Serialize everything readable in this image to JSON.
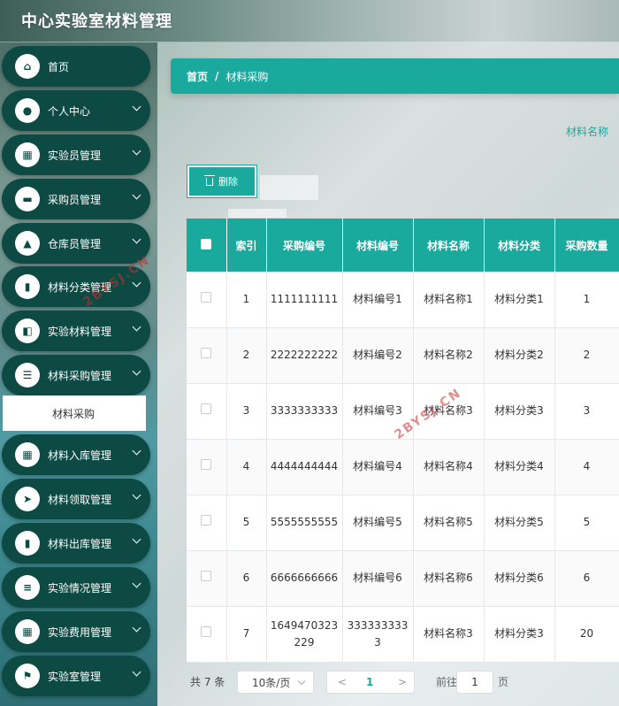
{
  "app": {
    "title": "中心实验室材料管理"
  },
  "sidebar": {
    "items": [
      {
        "label": "首页",
        "icon": "home-icon",
        "expandable": false
      },
      {
        "label": "个人中心",
        "icon": "user-icon",
        "expandable": true
      },
      {
        "label": "实验员管理",
        "icon": "grid-icon",
        "expandable": true
      },
      {
        "label": "采购员管理",
        "icon": "briefcase-icon",
        "expandable": true
      },
      {
        "label": "仓库员管理",
        "icon": "person-icon",
        "expandable": true
      },
      {
        "label": "材料分类管理",
        "icon": "bar-chart-icon",
        "expandable": true
      },
      {
        "label": "实验材料管理",
        "icon": "wallet-icon",
        "expandable": true
      },
      {
        "label": "材料采购管理",
        "icon": "list-icon",
        "expandable": true
      },
      {
        "label": "材料入库管理",
        "icon": "apps-icon",
        "expandable": true
      },
      {
        "label": "材料领取管理",
        "icon": "send-icon",
        "expandable": true
      },
      {
        "label": "材料出库管理",
        "icon": "book-icon",
        "expandable": true
      },
      {
        "label": "实验情况管理",
        "icon": "sliders-icon",
        "expandable": true
      },
      {
        "label": "实验费用管理",
        "icon": "grid-icon",
        "expandable": true
      },
      {
        "label": "实验室管理",
        "icon": "flag-icon",
        "expandable": true
      }
    ],
    "submenu": {
      "label": "材料采购"
    }
  },
  "watermark": "2BYSJ.CN",
  "breadcrumb": {
    "home": "首页",
    "sep": "/",
    "current": "材料采购"
  },
  "search": {
    "label": "材料名称"
  },
  "toolbar": {
    "delete_label": "删除"
  },
  "table": {
    "headers": [
      "",
      "索引",
      "采购编号",
      "材料编号",
      "材料名称",
      "材料分类",
      "采购数量"
    ],
    "rows": [
      [
        "",
        "1",
        "1111111111",
        "材料编号1",
        "材料名称1",
        "材料分类1",
        "1"
      ],
      [
        "",
        "2",
        "2222222222",
        "材料编号2",
        "材料名称2",
        "材料分类2",
        "2"
      ],
      [
        "",
        "3",
        "3333333333",
        "材料编号3",
        "材料名称3",
        "材料分类3",
        "3"
      ],
      [
        "",
        "4",
        "4444444444",
        "材料编号4",
        "材料名称4",
        "材料分类4",
        "4"
      ],
      [
        "",
        "5",
        "5555555555",
        "材料编号5",
        "材料名称5",
        "材料分类5",
        "5"
      ],
      [
        "",
        "6",
        "6666666666",
        "材料编号6",
        "材料名称6",
        "材料分类6",
        "6"
      ],
      [
        "",
        "7",
        "1649470323229",
        "3333333333",
        "材料名称3",
        "材料分类3",
        "20"
      ]
    ]
  },
  "pagination": {
    "total": "共 7 条",
    "page_size": "10条/页",
    "prev": "<",
    "current": "1",
    "next": ">",
    "goto_label": "前往",
    "goto_value": "1",
    "page_word": "页"
  }
}
